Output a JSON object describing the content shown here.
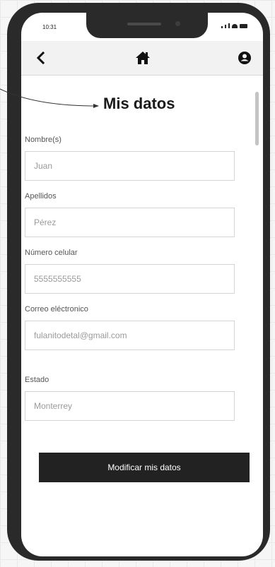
{
  "status_bar": {
    "time": "10:31"
  },
  "navbar": {
    "back_icon": "chevron-left-icon",
    "home_icon": "home-icon",
    "user_icon": "user-icon"
  },
  "page": {
    "title": "Mis datos"
  },
  "form": {
    "fields": [
      {
        "label": "Nombre(s)",
        "value": "Juan"
      },
      {
        "label": "Apellidos",
        "value": "Pérez"
      },
      {
        "label": "Número celular",
        "value": "5555555555"
      },
      {
        "label": "Correo eléctronico",
        "value": "fulanitodetal@gmail.com"
      },
      {
        "label": "Estado",
        "value": "Monterrey"
      }
    ],
    "submit_label": "Modificar mis datos"
  },
  "colors": {
    "button_bg": "#222222",
    "button_text": "#ffffff",
    "phone_frame": "#2a2a2a"
  }
}
